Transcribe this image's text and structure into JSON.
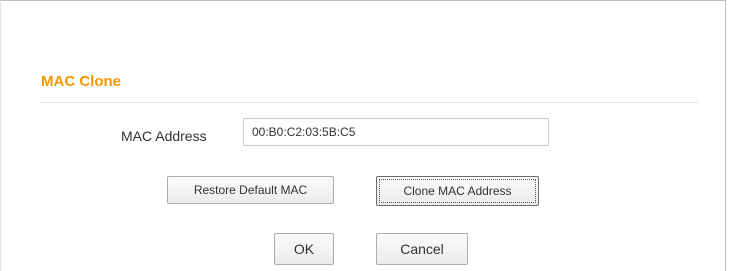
{
  "section": {
    "title": "MAC Clone"
  },
  "form": {
    "mac_address_label": "MAC Address",
    "mac_address_value": "00:B0:C2:03:5B:C5"
  },
  "buttons": {
    "restore_default": "Restore Default MAC",
    "clone_mac": "Clone MAC Address",
    "ok": "OK",
    "cancel": "Cancel"
  },
  "colors": {
    "title_accent": "#f39800"
  }
}
